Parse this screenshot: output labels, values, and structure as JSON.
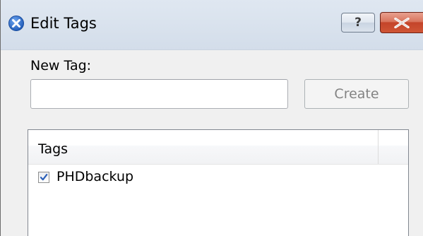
{
  "window": {
    "title": "Edit Tags",
    "help_label": "?",
    "colors": {
      "titlebar": "#dae3ee",
      "close_button": "#c4442a",
      "app_icon": "#2d6fd0"
    }
  },
  "icons": {
    "app": "app-logo-icon",
    "close": "close-icon",
    "check": "checkmark-icon"
  },
  "form": {
    "new_tag_label": "New Tag:",
    "new_tag_value": "",
    "create_label": "Create"
  },
  "tags": {
    "header": "Tags",
    "items": [
      {
        "label": "PHDbackup",
        "checked": true
      }
    ]
  }
}
